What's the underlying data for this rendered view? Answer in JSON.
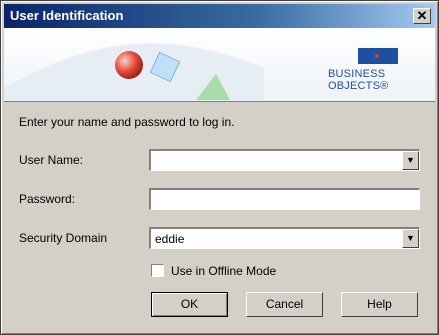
{
  "window": {
    "title": "User Identification",
    "close_glyph": "✕"
  },
  "banner": {
    "logo_text": "BUSINESS OBJECTS",
    "logo_mark": "®"
  },
  "prompt": "Enter your name and password to log in.",
  "form": {
    "user_name": {
      "label": "User Name:",
      "value": ""
    },
    "password": {
      "label": "Password:",
      "value": ""
    },
    "domain": {
      "label": "Security Domain",
      "value": "eddie"
    }
  },
  "offline": {
    "label": "Use in Offline Mode",
    "checked": false
  },
  "buttons": {
    "ok": "OK",
    "cancel": "Cancel",
    "help": "Help"
  },
  "colors": {
    "titlebar_start": "#0a246a",
    "titlebar_end": "#a6caf0",
    "brand": "#1e4fa1",
    "face": "#d4d0c8"
  },
  "icons": {
    "dropdown": "▼"
  }
}
